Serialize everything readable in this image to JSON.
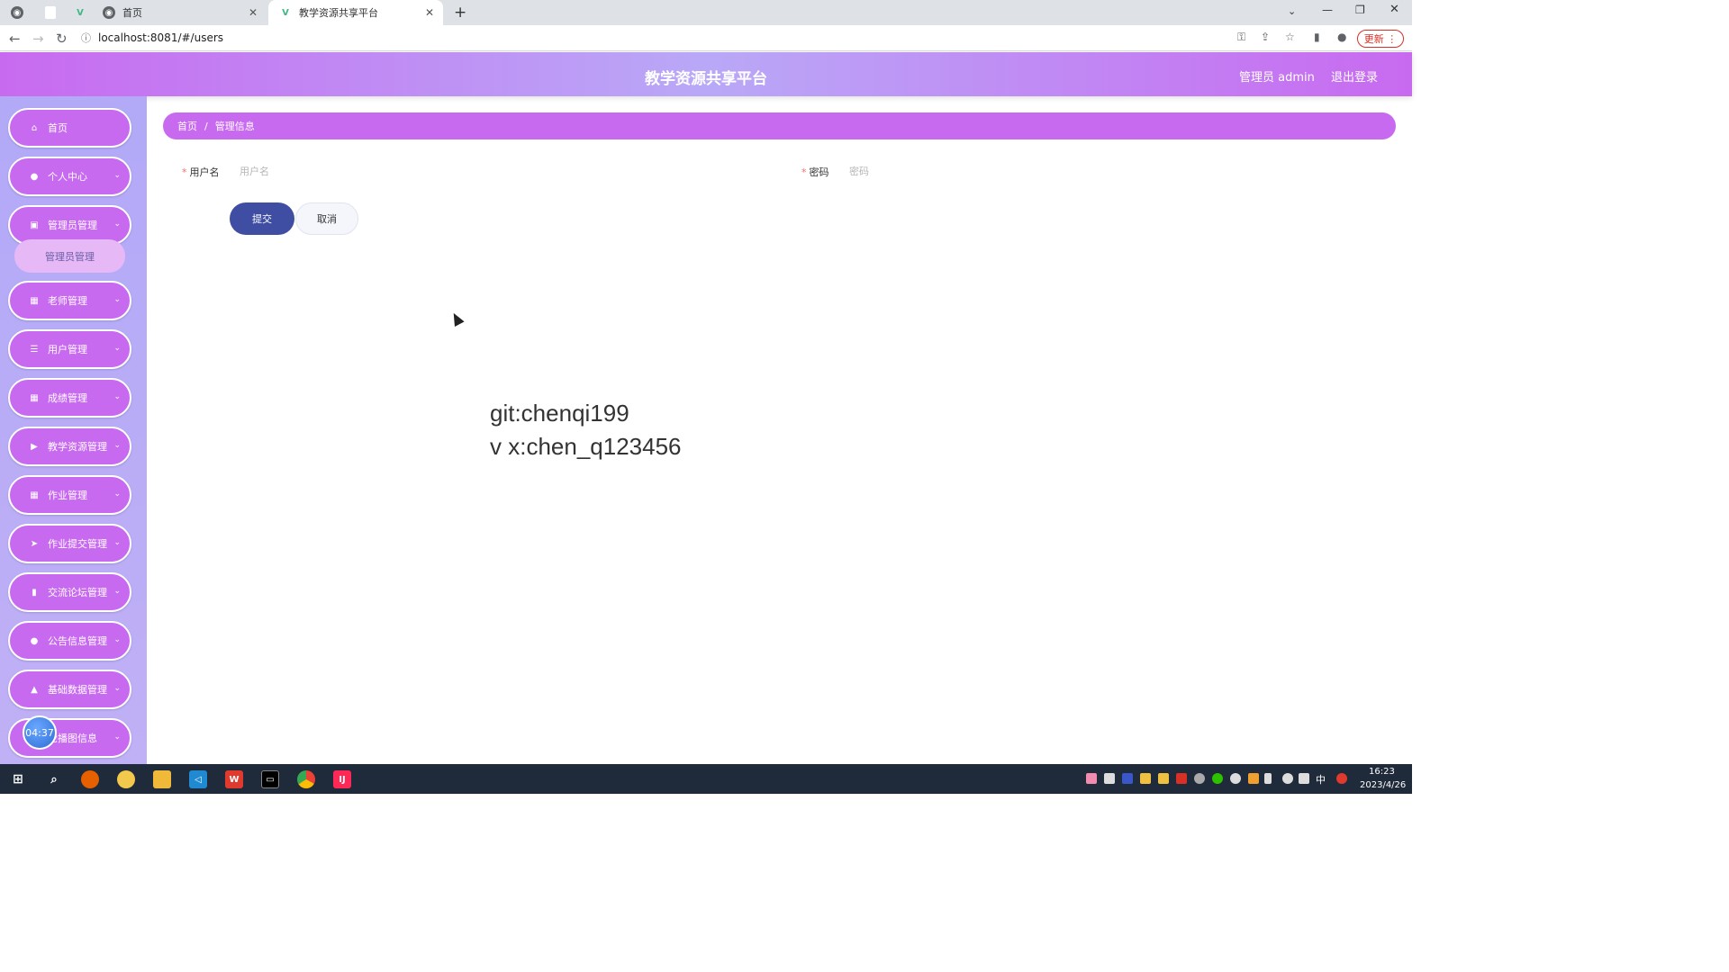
{
  "browser": {
    "tabs": [
      {
        "title": "",
        "icon": "globe-icon"
      },
      {
        "title": "",
        "icon": "blank-icon"
      },
      {
        "title": "",
        "icon": "vue-icon"
      },
      {
        "title": "首页",
        "icon": "globe-icon"
      },
      {
        "title": "教学资源共享平台",
        "icon": "vue-icon",
        "active": true
      }
    ],
    "url": "localhost:8081/#/users",
    "update_label": "更新"
  },
  "header": {
    "title": "教学资源共享平台",
    "admin": "管理员 admin",
    "logout": "退出登录"
  },
  "sidebar": {
    "items": [
      {
        "label": "首页",
        "icon": "home-icon",
        "has_children": false
      },
      {
        "label": "个人中心",
        "icon": "user-icon",
        "has_children": true
      },
      {
        "label": "管理员管理",
        "icon": "clipboard-icon",
        "has_children": true,
        "expanded": true
      },
      {
        "label": "老师管理",
        "icon": "grid-icon",
        "has_children": true
      },
      {
        "label": "用户管理",
        "icon": "list-icon",
        "has_children": true
      },
      {
        "label": "成绩管理",
        "icon": "grid-icon",
        "has_children": true
      },
      {
        "label": "教学资源管理",
        "icon": "video-icon",
        "has_children": true
      },
      {
        "label": "作业管理",
        "icon": "grid-icon",
        "has_children": true
      },
      {
        "label": "作业提交管理",
        "icon": "send-icon",
        "has_children": true
      },
      {
        "label": "交流论坛管理",
        "icon": "bar-chart-icon",
        "has_children": true
      },
      {
        "label": "公告信息管理",
        "icon": "bulb-icon",
        "has_children": true
      },
      {
        "label": "基础数据管理",
        "icon": "thumb-icon",
        "has_children": true
      },
      {
        "label": "轮播图信息",
        "icon": "image-icon",
        "has_children": true
      }
    ],
    "submenu_label": "管理员管理",
    "timer": "04:37"
  },
  "breadcrumb": {
    "home": "首页",
    "separator": "/",
    "current": "管理信息"
  },
  "form": {
    "username_label": "用户名",
    "username_placeholder": "用户名",
    "username_value": "",
    "password_label": "密码",
    "password_placeholder": "密码",
    "password_value": "",
    "required_mark": "*",
    "submit": "提交",
    "cancel": "取消"
  },
  "overlay": {
    "line1": "git:chenqi199",
    "line2": "v x:chen_q123456"
  },
  "taskbar": {
    "ime": "中",
    "time": "16:23",
    "date": "2023/4/26"
  }
}
